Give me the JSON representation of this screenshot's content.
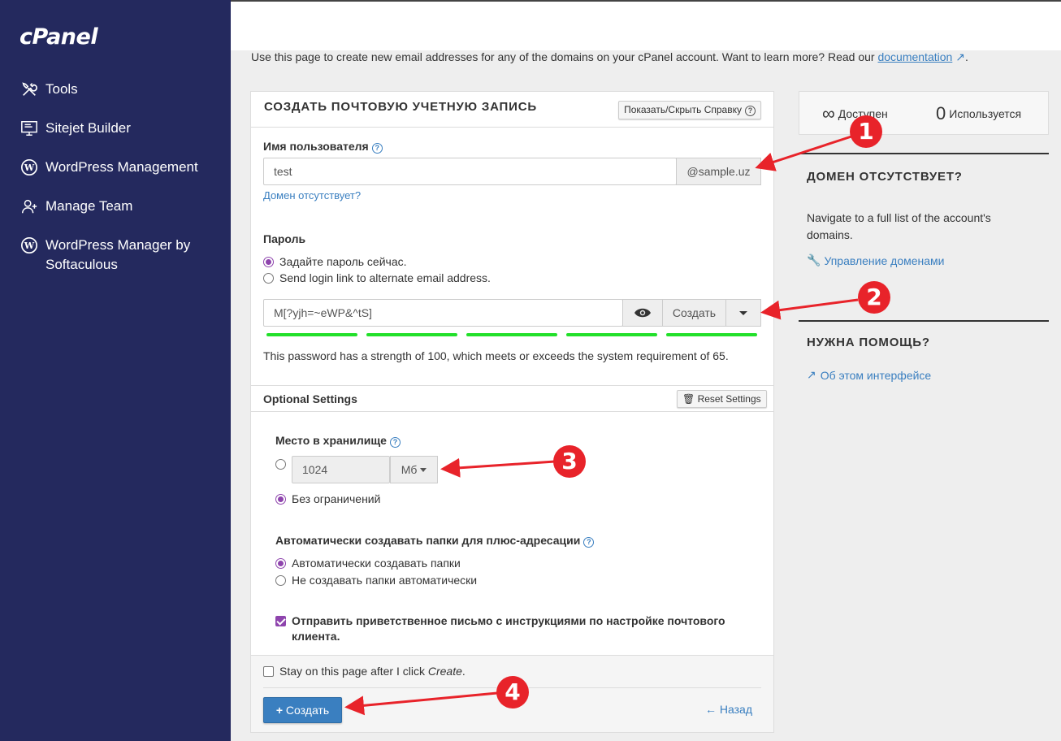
{
  "brand": "cPanel",
  "sidebar": {
    "items": [
      {
        "label": "Tools",
        "icon": "tools-icon"
      },
      {
        "label": "Sitejet Builder",
        "icon": "sitejet-icon"
      },
      {
        "label": "WordPress Management",
        "icon": "wordpress-icon"
      },
      {
        "label": "Manage Team",
        "icon": "manage-team-icon"
      },
      {
        "label": "WordPress Manager by Softaculous",
        "icon": "wordpress-icon"
      }
    ]
  },
  "intro": {
    "text": "Use this page to create new email addresses for any of the domains on your cPanel account. Want to learn more? Read our ",
    "link": "documentation",
    "tail": "."
  },
  "form": {
    "title": "СОЗДАТЬ ПОЧТОВУЮ УЧЕТНУЮ ЗАПИСЬ",
    "help_toggle": "Показать/Скрыть Справку",
    "username_label": "Имя пользователя",
    "username_value": "test",
    "domain": "@sample.uz",
    "domain_missing": "Домен отсутствует?",
    "password_label": "Пароль",
    "pw_option_set": "Задайте пароль сейчас.",
    "pw_option_link": "Send login link to alternate email address.",
    "password_value": "M[?yjh=~eWP&^tS]",
    "generate_label": "Создать",
    "strength_text": "This password has a strength of 100, which meets or exceeds the system requirement of 65.",
    "optional_title": "Optional Settings",
    "reset_settings": "Reset Settings",
    "storage_label": "Место в хранилище",
    "storage_value": "1024",
    "storage_unit": "Мб",
    "storage_unlimited": "Без ограничений",
    "plus_label": "Автоматически создавать папки для плюс-адресации",
    "plus_auto": "Автоматически создавать папки",
    "plus_manual": "Не создавать папки автоматически",
    "welcome_email": "Отправить приветственное письмо с инструкциями по настройке почтового клиента.",
    "stay_prefix": "Stay on this page after I click ",
    "stay_create": "Create",
    "stay_suffix": ".",
    "create_button": "Создать",
    "back_link": "Назад"
  },
  "stats": {
    "available_value": "∞",
    "available_label": "Доступен",
    "used_value": "0",
    "used_label": "Используется"
  },
  "right": {
    "domain_missing_title": "ДОМЕН ОТСУТСТВУЕТ?",
    "domain_missing_text": "Navigate to a full list of the account's domains.",
    "manage_domains": "Управление доменами",
    "help_title": "НУЖНА ПОМОЩЬ?",
    "about_link": "Об этом интерфейсе"
  },
  "markers": [
    "1",
    "2",
    "3",
    "4"
  ],
  "colors": {
    "sidebar": "#24295e",
    "accent": "#3a7fc0",
    "radio": "#8e44ad",
    "strength": "#22e02a",
    "marker": "#e8232a"
  }
}
